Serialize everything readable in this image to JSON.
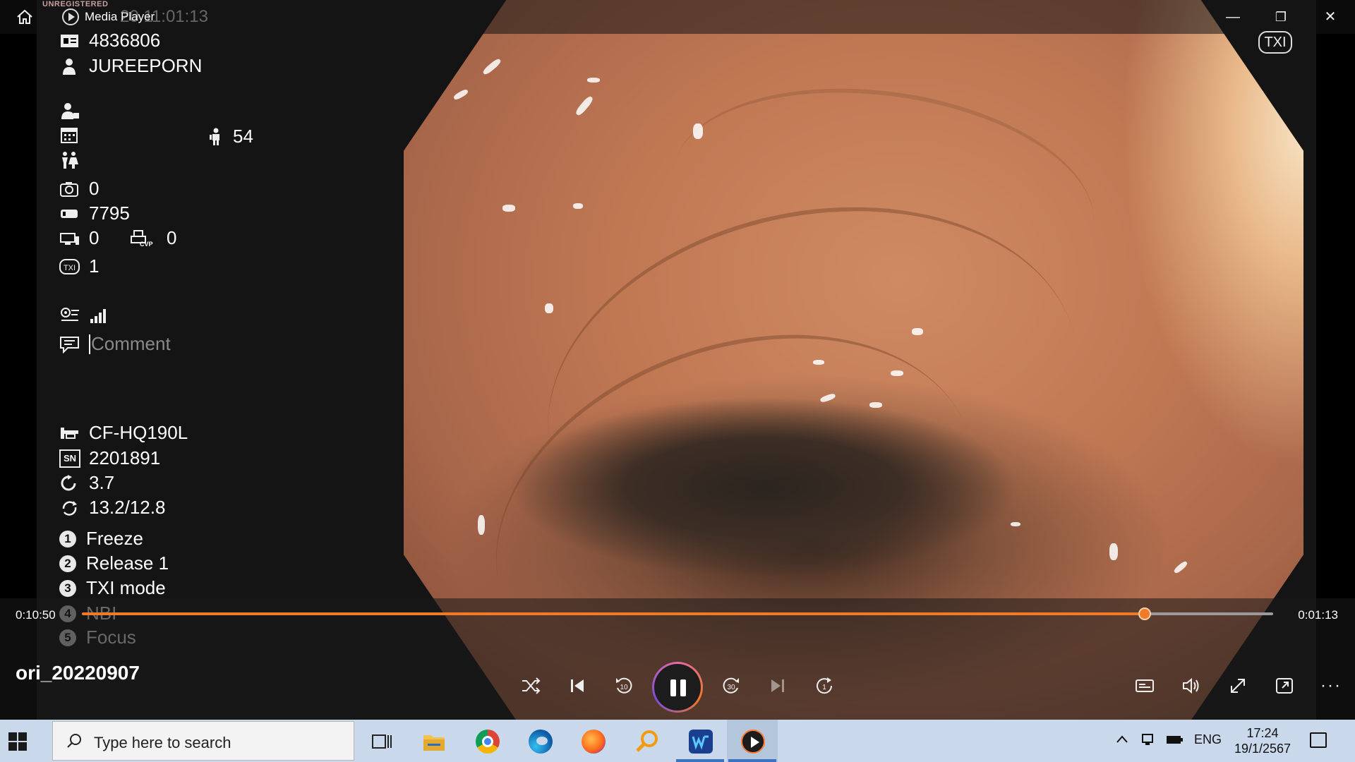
{
  "titlebar": {
    "app_title": "Media Player",
    "watermark": "UNREGISTERED",
    "overlay_time_ghost": "20 11:01:13",
    "minimize": "—",
    "restore": "❐",
    "close": "✕"
  },
  "overlay": {
    "badge": "TXI",
    "patient_id": "4836806",
    "patient_name": "JUREEPORN",
    "age": "54",
    "capture_count": "0",
    "counter": "7795",
    "vp_count": "0",
    "cvp_count": "0",
    "cvp_label": "CVP",
    "txi_level": "1",
    "comment_placeholder": "Comment",
    "scope_model": "CF-HQ190L",
    "serial_label": "SN",
    "serial_number": "2201891",
    "rotation_value": "3.7",
    "flex_value": "13.2/12.8",
    "button_functions": [
      {
        "num": "1",
        "label": "Freeze"
      },
      {
        "num": "2",
        "label": "Release 1"
      },
      {
        "num": "3",
        "label": "TXI mode"
      },
      {
        "num": "4",
        "label": "NBI"
      },
      {
        "num": "5",
        "label": "Focus"
      }
    ]
  },
  "player": {
    "elapsed": "0:10:50",
    "remaining": "0:01:13",
    "progress_fraction": 0.892,
    "filename": "ori_20220907",
    "accent_color": "#f07a26"
  },
  "taskbar": {
    "search_placeholder": "Type here to search",
    "language": "ENG",
    "time": "17:24",
    "date": "19/1/2567",
    "apps": [
      "task-view-icon",
      "file-explorer-icon",
      "chrome-icon",
      "edge-icon",
      "firefox-icon",
      "search-tool-icon",
      "word-icon",
      "media-player-icon"
    ]
  }
}
